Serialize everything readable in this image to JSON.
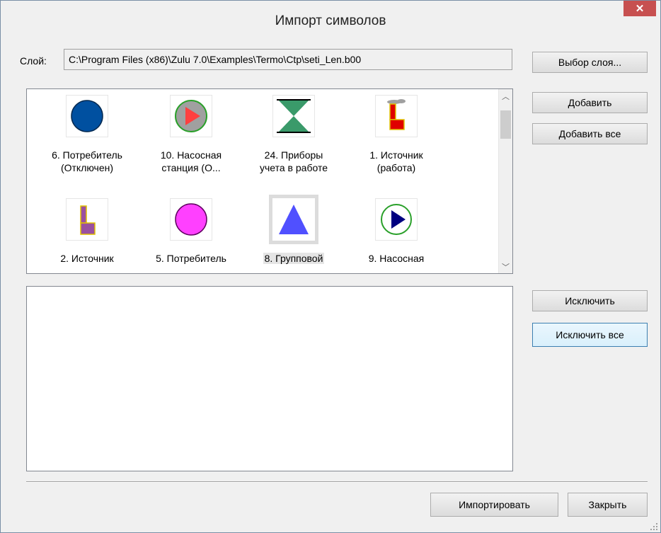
{
  "window": {
    "title": "Импорт символов",
    "close_glyph": "✕"
  },
  "layer": {
    "label": "Слой:",
    "path": "C:\\Program Files (x86)\\Zulu 7.0\\Examples\\Termo\\Ctp\\seti_Len.b00",
    "choose_button": "Выбор слоя..."
  },
  "buttons": {
    "add": "Добавить",
    "add_all": "Добавить все",
    "exclude": "Исключить",
    "exclude_all": "Исключить все",
    "import": "Импортировать",
    "close": "Закрыть"
  },
  "symbols": [
    {
      "line1": "6. Потребитель",
      "line2": "(Отключен)",
      "icon": "dark-blue-circle-icon"
    },
    {
      "line1": "10. Насосная",
      "line2": "станция (О...",
      "icon": "gray-pump-station-icon"
    },
    {
      "line1": "24. Приборы",
      "line2": "учета в работе",
      "icon": "green-hourglass-meter-icon"
    },
    {
      "line1": "1. Источник",
      "line2": "(работа)",
      "icon": "red-factory-source-icon"
    },
    {
      "line1": "2. Источник",
      "line2": "",
      "icon": "purple-factory-source-icon"
    },
    {
      "line1": "5. Потребитель",
      "line2": "",
      "icon": "magenta-circle-icon"
    },
    {
      "line1": "8. Групповой",
      "line2": "",
      "icon": "blue-triangle-icon",
      "selected": true
    },
    {
      "line1": "9. Насосная",
      "line2": "",
      "icon": "blue-pump-station-icon"
    }
  ],
  "colors": {
    "consumer_off": "#0050a0",
    "pump_gray": "#a0a0a0",
    "pump_arrow": "#ff4040",
    "meter_green": "#3a9a6a",
    "source_red": "#e00000",
    "source_purple": "#9a50a0",
    "consumer_on": "#ff40ff",
    "group_blue": "#5050ff",
    "pump_blue": "#000080"
  }
}
